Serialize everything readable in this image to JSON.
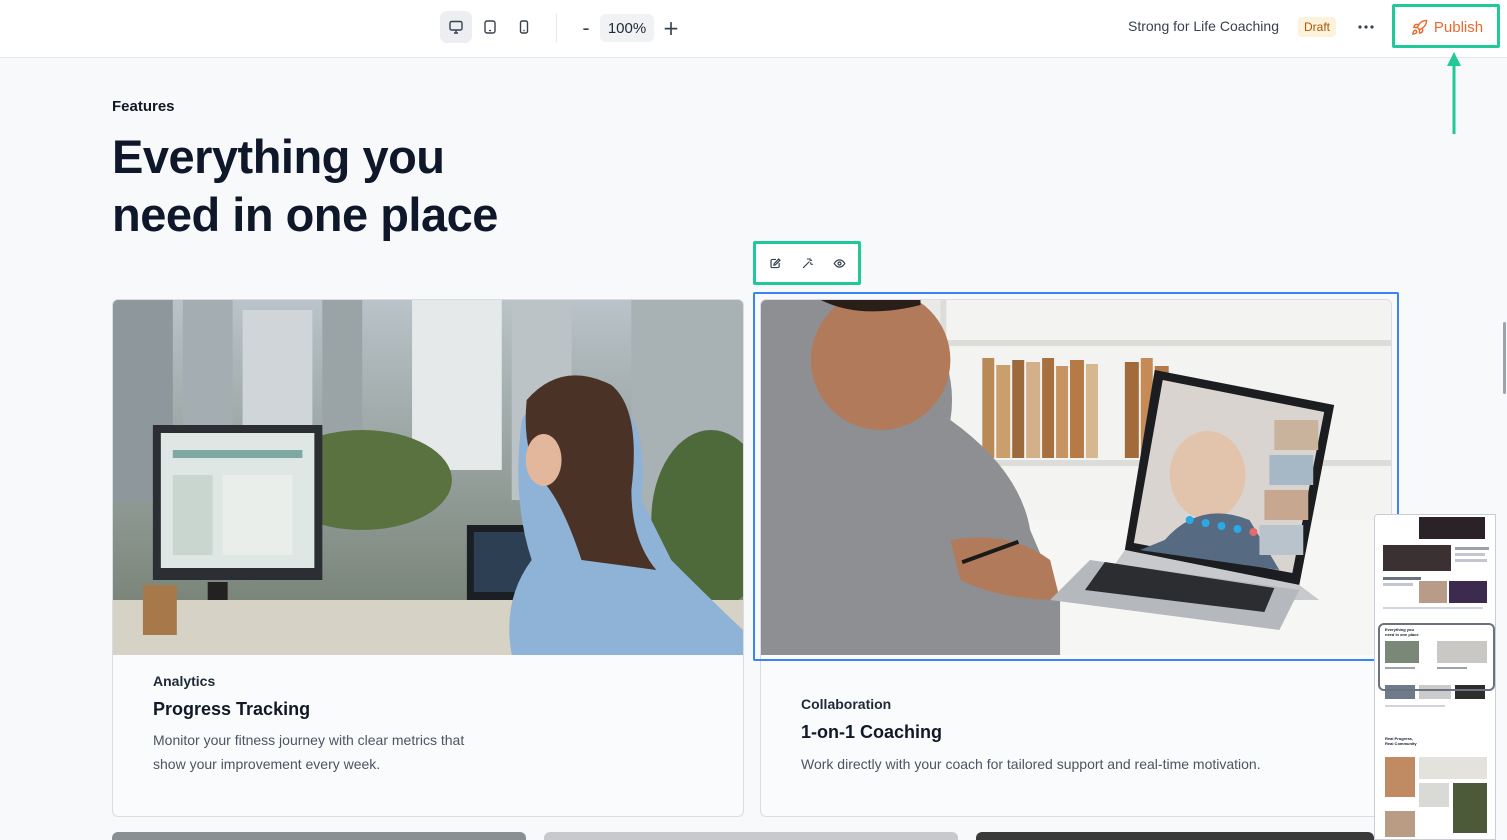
{
  "toolbar": {
    "device_buttons": [
      {
        "icon": "desktop-icon",
        "active": true
      },
      {
        "icon": "tablet-icon",
        "active": false
      },
      {
        "icon": "mobile-icon",
        "active": false
      }
    ],
    "zoom_out": "-",
    "zoom_level": "100%",
    "zoom_in": "+",
    "site_name": "Strong for Life Coaching",
    "status_badge": "Draft",
    "more_icon": "more-horizontal-icon",
    "publish_label": "Publish",
    "publish_icon": "rocket-icon"
  },
  "section": {
    "eyebrow": "Features",
    "headline_line1": "Everything you",
    "headline_line2": "need in one place"
  },
  "edit_toolbar": {
    "icons": [
      "edit-icon",
      "magic-wand-icon",
      "eye-icon"
    ]
  },
  "cards": [
    {
      "category": "Analytics",
      "title": "Progress Tracking",
      "description": "Monitor your fitness journey with clear metrics that show your improvement every week."
    },
    {
      "category": "Collaboration",
      "title": "1-on-1 Coaching",
      "description": "Work directly with your coach for tailored support and real-time motivation."
    }
  ],
  "minimap": {
    "line1": "Everything you",
    "line2": "need in one place",
    "line3": "Real Progress,",
    "line4": "Real Community"
  },
  "colors": {
    "accent_highlight": "#20c997",
    "selection": "#3b82f6",
    "publish": "#ea6a2e",
    "draft_bg": "#fdf3dc"
  }
}
